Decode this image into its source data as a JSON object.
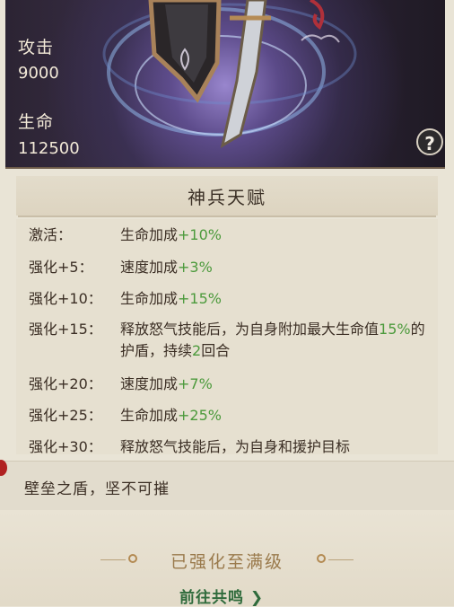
{
  "stats": {
    "attack_label": "攻击",
    "attack_value": "9000",
    "hp_label": "生命",
    "hp_value": "112500"
  },
  "help_button": "?",
  "talent": {
    "title": "神兵天赋",
    "rows": [
      {
        "req": "激活：",
        "desc_pre": "生命加成",
        "desc_val": "+10%"
      },
      {
        "req": "强化+5：",
        "desc_pre": "速度加成",
        "desc_val": "+3%"
      },
      {
        "req": "强化+10：",
        "desc_pre": "生命加成",
        "desc_val": "+15%"
      },
      {
        "req": "强化+15：",
        "desc_pre": "释放怒气技能后，为自身附加最大生命值",
        "desc_val": "15%",
        "desc_post": "的护盾，持续",
        "desc_val2": "2",
        "desc_post2": "回合"
      },
      {
        "req": "强化+20：",
        "desc_pre": "速度加成",
        "desc_val": "+7%"
      },
      {
        "req": "强化+25：",
        "desc_pre": "生命加成",
        "desc_val": "+25%"
      },
      {
        "req": "强化+30：",
        "desc_pre": "释放怒气技能后，为自身和援护目标"
      }
    ]
  },
  "quote": "壁垒之盾，坚不可摧",
  "status": "已强化至满级",
  "resonate_link": "前往共鸣",
  "resonate_arrow": "❯",
  "colors": {
    "highlight_green": "#4c9a3c",
    "link_green": "#2f6b3c",
    "gold": "#9a7a4c"
  }
}
